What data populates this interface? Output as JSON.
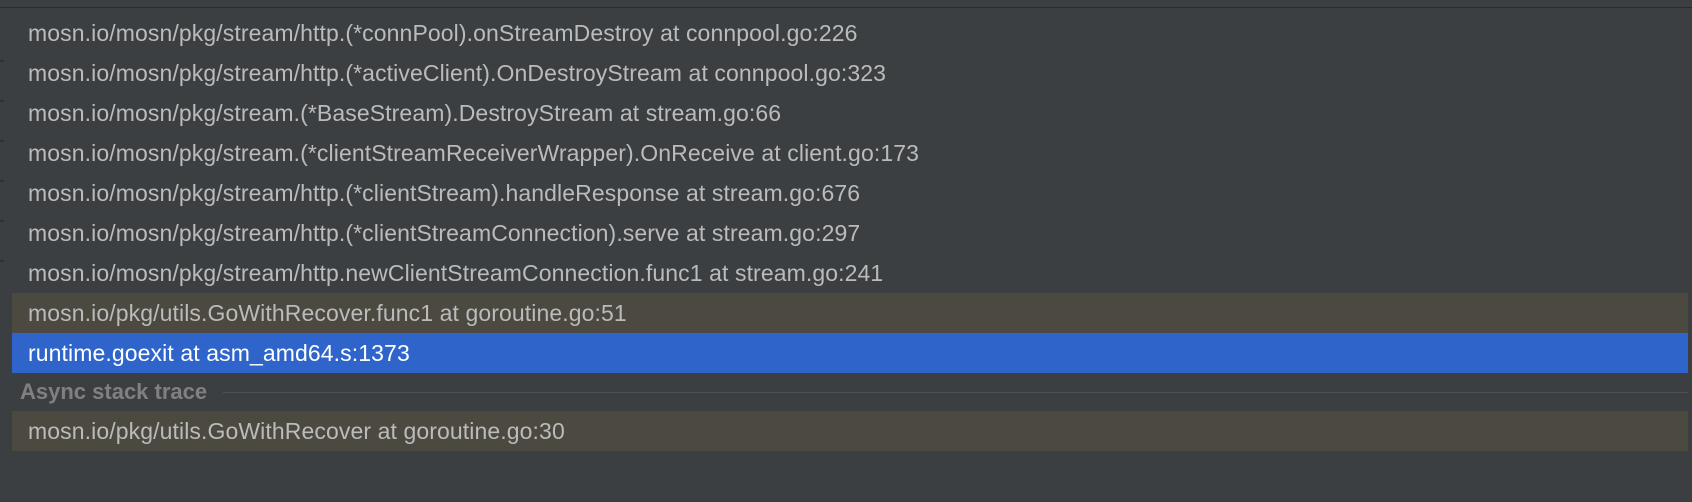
{
  "frames_panel": {
    "frames": [
      {
        "text": "mosn.io/mosn/pkg/stream/http.(*connPool).onStreamDestroy at connpool.go:226",
        "kind": "normal"
      },
      {
        "text": "mosn.io/mosn/pkg/stream/http.(*activeClient).OnDestroyStream at connpool.go:323",
        "kind": "normal"
      },
      {
        "text": "mosn.io/mosn/pkg/stream.(*BaseStream).DestroyStream at stream.go:66",
        "kind": "normal"
      },
      {
        "text": "mosn.io/mosn/pkg/stream.(*clientStreamReceiverWrapper).OnReceive at client.go:173",
        "kind": "normal"
      },
      {
        "text": "mosn.io/mosn/pkg/stream/http.(*clientStream).handleResponse at stream.go:676",
        "kind": "normal"
      },
      {
        "text": "mosn.io/mosn/pkg/stream/http.(*clientStreamConnection).serve at stream.go:297",
        "kind": "normal"
      },
      {
        "text": "mosn.io/mosn/pkg/stream/http.newClientStreamConnection.func1 at stream.go:241",
        "kind": "normal"
      },
      {
        "text": "mosn.io/pkg/utils.GoWithRecover.func1 at goroutine.go:51",
        "kind": "library"
      },
      {
        "text": "runtime.goexit at asm_amd64.s:1373",
        "kind": "selected"
      }
    ],
    "async_separator": "Async stack trace",
    "async_frames": [
      {
        "text": "mosn.io/pkg/utils.GoWithRecover at goroutine.go:30",
        "kind": "library"
      }
    ]
  },
  "colors": {
    "background": "#3c3f41",
    "text": "#bbbbbb",
    "library_row": "#4c4940",
    "selected_row": "#2f65ca",
    "separator_text": "#808080"
  }
}
